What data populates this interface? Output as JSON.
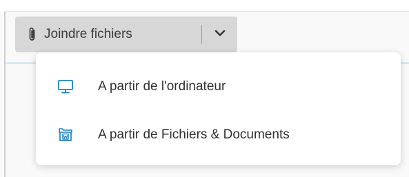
{
  "attach_button": {
    "label": "Joindre fichiers",
    "icon": "paperclip-icon",
    "toggle_icon": "chevron-down-icon"
  },
  "menu": {
    "items": [
      {
        "label": "A partir de l'ordinateur",
        "icon": "monitor-icon"
      },
      {
        "label": "A partir de Fichiers & Documents",
        "icon": "document-library-icon"
      }
    ]
  },
  "colors": {
    "icon_blue": "#1c7fbf",
    "button_bg": "#d7d7d7",
    "accent_line": "#6fb6df"
  }
}
